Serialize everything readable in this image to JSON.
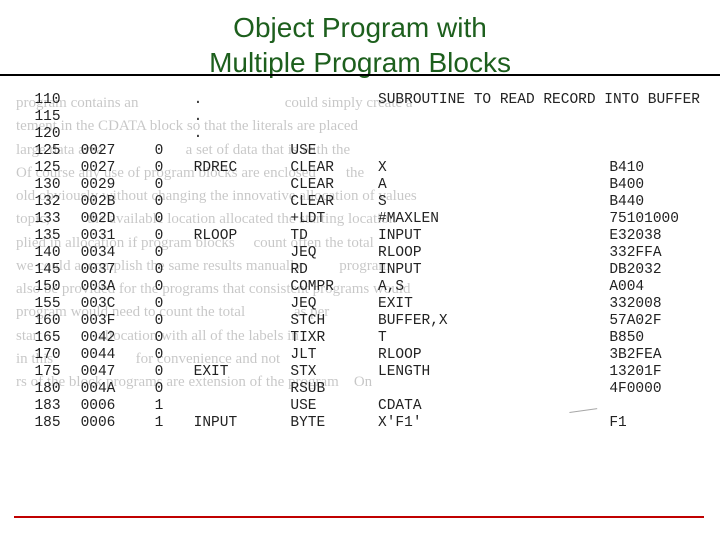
{
  "title_line1": "Object Program with",
  "title_line2": "Multiple Program Blocks",
  "comment_banner": "SUBROUTINE TO READ RECORD INTO BUFFER",
  "ghost_lines": [
    "program contains an                                       could simply create a",
    "tement in the CDATA block so that the literals are placed",
    "large data area                      a set of data that is with the",
    "Of course any use of program blocks are enclosed        the",
    "old obviously without changing the innovative allocation of values",
    "topic,          the available location allocated the starting location",
    "plied in allocation if program blocks     count often the total",
    "we could accomplish the same results manually          program",
    "also be provided for the programs that consistent programs would",
    "program would need to count the total             as per",
    "start               allocation with all of the labels in",
    "in this                      for convenience and not",
    "rs of the block programs are extension of the program    On",
    ""
  ],
  "rows": [
    {
      "ln": "115",
      "loc": "",
      "blk": "",
      "lbl": ".",
      "op": "",
      "arg": "",
      "obj": ""
    },
    {
      "ln": "120",
      "loc": "",
      "blk": "",
      "lbl": ".",
      "op": "",
      "arg": "",
      "obj": ""
    },
    {
      "ln": "125",
      "loc": "0027",
      "blk": "0",
      "lbl": "",
      "op": "USE",
      "arg": "",
      "obj": ""
    },
    {
      "ln": "125",
      "loc": "0027",
      "blk": "0",
      "lbl": "RDREC",
      "op": "CLEAR",
      "arg": "X",
      "obj": "B410"
    },
    {
      "ln": "130",
      "loc": "0029",
      "blk": "0",
      "lbl": "",
      "op": "CLEAR",
      "arg": "A",
      "obj": "B400"
    },
    {
      "ln": "132",
      "loc": "002B",
      "blk": "0",
      "lbl": "",
      "op": "CLEAR",
      "arg": "S",
      "obj": "B440"
    },
    {
      "ln": "133",
      "loc": "002D",
      "blk": "0",
      "lbl": "",
      "op": "+LDT",
      "arg": "#MAXLEN",
      "obj": "75101000"
    },
    {
      "ln": "135",
      "loc": "0031",
      "blk": "0",
      "lbl": "RLOOP",
      "op": "TD",
      "arg": "INPUT",
      "obj": "E32038"
    },
    {
      "ln": "140",
      "loc": "0034",
      "blk": "0",
      "lbl": "",
      "op": "JEQ",
      "arg": "RLOOP",
      "obj": "332FFA"
    },
    {
      "ln": "145",
      "loc": "0037",
      "blk": "0",
      "lbl": "",
      "op": "RD",
      "arg": "INPUT",
      "obj": "DB2032"
    },
    {
      "ln": "150",
      "loc": "003A",
      "blk": "0",
      "lbl": "",
      "op": "COMPR",
      "arg": "A,S",
      "obj": "A004"
    },
    {
      "ln": "155",
      "loc": "003C",
      "blk": "0",
      "lbl": "",
      "op": "JEQ",
      "arg": "EXIT",
      "obj": "332008"
    },
    {
      "ln": "160",
      "loc": "003F",
      "blk": "0",
      "lbl": "",
      "op": "STCH",
      "arg": "BUFFER,X",
      "obj": "57A02F"
    },
    {
      "ln": "165",
      "loc": "0042",
      "blk": "0",
      "lbl": "",
      "op": "TIXR",
      "arg": "T",
      "obj": "B850"
    },
    {
      "ln": "170",
      "loc": "0044",
      "blk": "0",
      "lbl": "",
      "op": "JLT",
      "arg": "RLOOP",
      "obj": "3B2FEA"
    },
    {
      "ln": "175",
      "loc": "0047",
      "blk": "0",
      "lbl": "EXIT",
      "op": "STX",
      "arg": "LENGTH",
      "obj": "13201F"
    },
    {
      "ln": "180",
      "loc": "004A",
      "blk": "0",
      "lbl": "",
      "op": "RSUB",
      "arg": "",
      "obj": "4F0000"
    },
    {
      "ln": "183",
      "loc": "0006",
      "blk": "1",
      "lbl": "",
      "op": "USE",
      "arg": "CDATA",
      "obj": ""
    },
    {
      "ln": "185",
      "loc": "0006",
      "blk": "1",
      "lbl": "INPUT",
      "op": "BYTE",
      "arg": "X'F1'",
      "obj": "F1"
    }
  ]
}
